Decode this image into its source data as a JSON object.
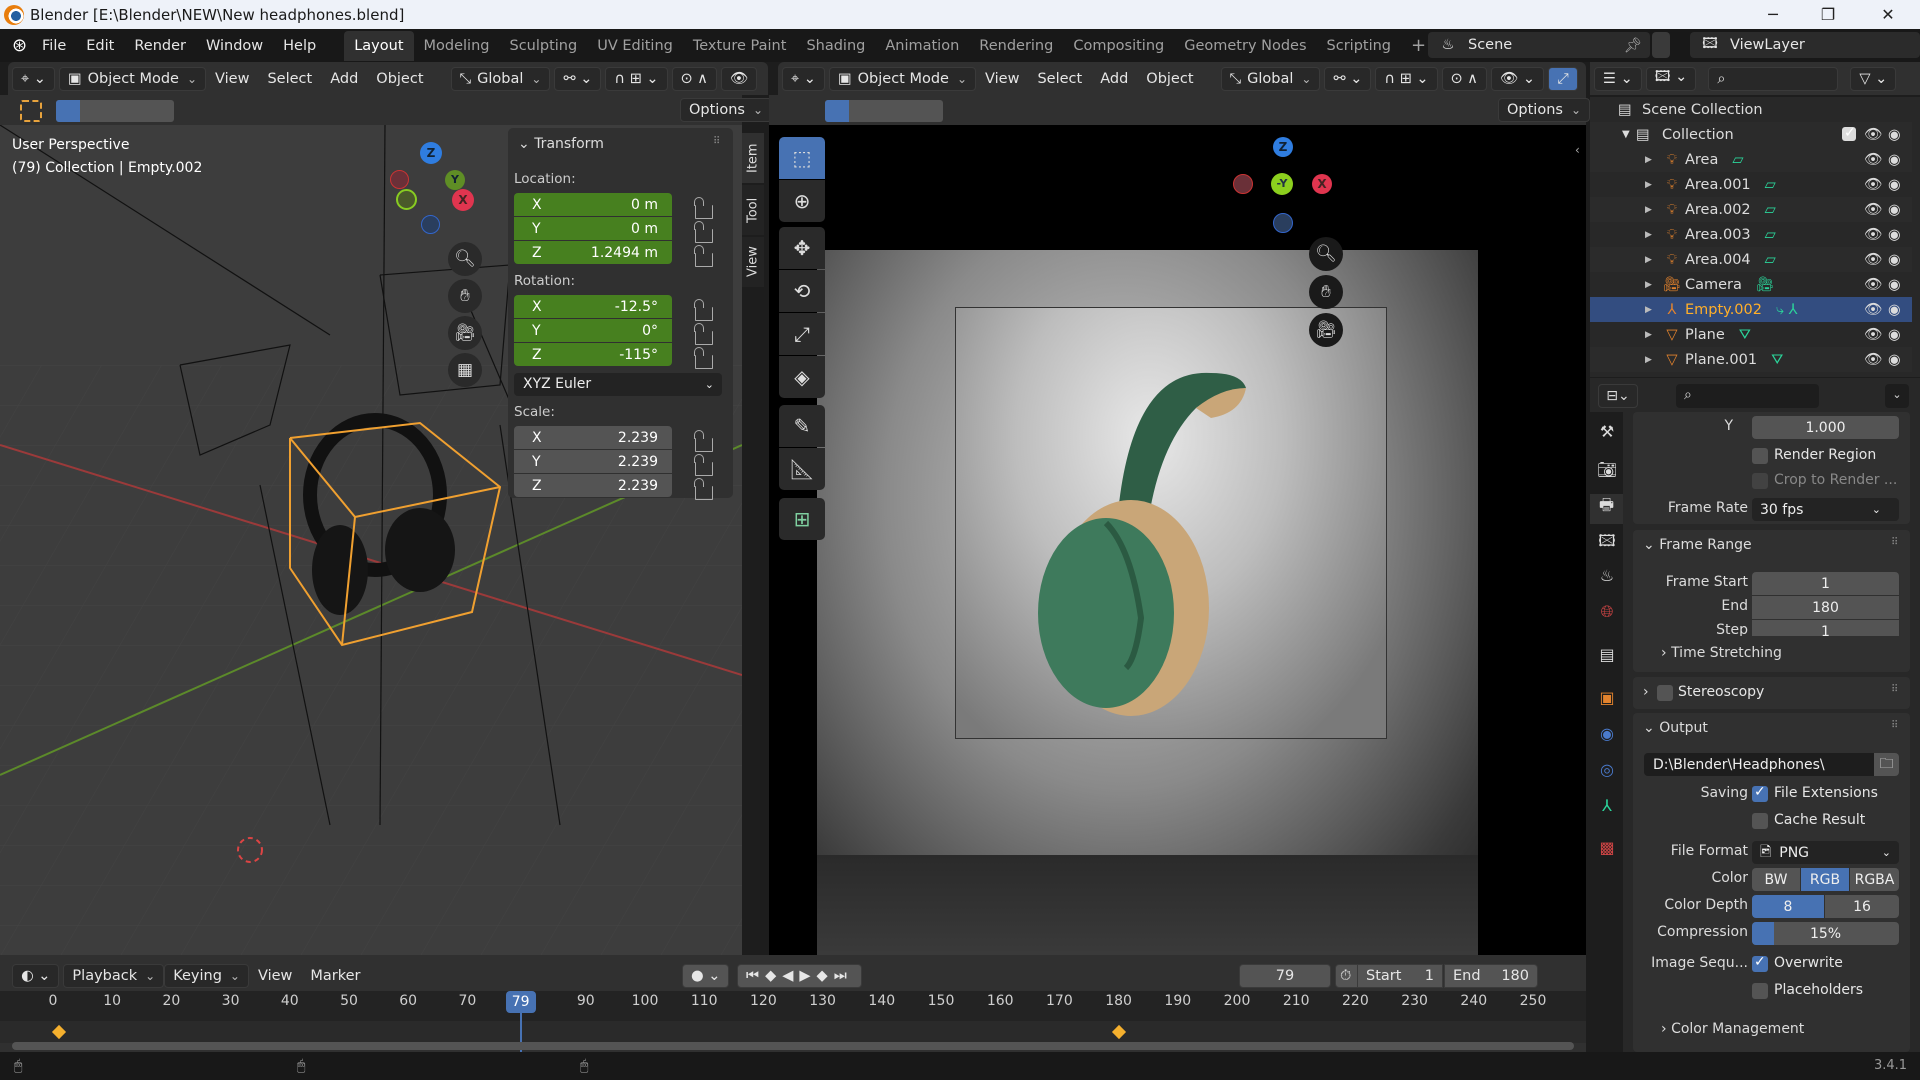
{
  "window": {
    "title": "Blender [E:\\Blender\\NEW\\New headphones.blend]",
    "controls": [
      "minimize",
      "maximize",
      "close"
    ]
  },
  "menu": [
    "File",
    "Edit",
    "Render",
    "Window",
    "Help"
  ],
  "workspaces": [
    {
      "label": "Layout",
      "active": true
    },
    {
      "label": "Modeling"
    },
    {
      "label": "Sculpting"
    },
    {
      "label": "UV Editing"
    },
    {
      "label": "Texture Paint"
    },
    {
      "label": "Shading"
    },
    {
      "label": "Animation"
    },
    {
      "label": "Rendering"
    },
    {
      "label": "Compositing"
    },
    {
      "label": "Geometry Nodes"
    },
    {
      "label": "Scripting"
    },
    {
      "label": "+"
    }
  ],
  "scene": {
    "name": "Scene",
    "view_layer": "ViewLayer"
  },
  "viewport_left": {
    "mode": "Object Mode",
    "menus": [
      "View",
      "Select",
      "Add",
      "Object"
    ],
    "orientation": "Global",
    "options_label": "Options",
    "overlay_title": "User Perspective",
    "overlay_subtitle": "(79) Collection | Empty.002",
    "gizmo_axes": [
      "Z",
      "Y",
      "X"
    ],
    "side_tabs": [
      "Item",
      "Tool",
      "View"
    ],
    "transform": {
      "title": "Transform",
      "location_label": "Location:",
      "location": [
        {
          "axis": "X",
          "value": "0 m"
        },
        {
          "axis": "Y",
          "value": "0 m"
        },
        {
          "axis": "Z",
          "value": "1.2494 m"
        }
      ],
      "rotation_label": "Rotation:",
      "rotation": [
        {
          "axis": "X",
          "value": "-12.5°"
        },
        {
          "axis": "Y",
          "value": "0°"
        },
        {
          "axis": "Z",
          "value": "-115°"
        }
      ],
      "rotation_mode": "XYZ Euler",
      "scale_label": "Scale:",
      "scale": [
        {
          "axis": "X",
          "value": "2.239"
        },
        {
          "axis": "Y",
          "value": "2.239"
        },
        {
          "axis": "Z",
          "value": "2.239"
        }
      ]
    }
  },
  "viewport_right": {
    "mode": "Object Mode",
    "menus": [
      "View",
      "Select",
      "Add",
      "Object"
    ],
    "orientation": "Global",
    "options_label": "Options",
    "gizmo_axes": [
      "Z",
      "-Y",
      "X"
    ]
  },
  "outliner": {
    "root": "Scene Collection",
    "collection": "Collection",
    "items": [
      {
        "name": "Area",
        "type": "light"
      },
      {
        "name": "Area.001",
        "type": "light"
      },
      {
        "name": "Area.002",
        "type": "light"
      },
      {
        "name": "Area.003",
        "type": "light"
      },
      {
        "name": "Area.004",
        "type": "light"
      },
      {
        "name": "Camera",
        "type": "camera"
      },
      {
        "name": "Empty.002",
        "type": "empty",
        "selected": true
      },
      {
        "name": "Plane",
        "type": "mesh"
      },
      {
        "name": "Plane.001",
        "type": "mesh"
      }
    ]
  },
  "properties": {
    "aspect_y_label": "Y",
    "aspect_y": "1.000",
    "render_region": "Render Region",
    "crop_to_render": "Crop to Render ...",
    "frame_rate_label": "Frame Rate",
    "frame_rate": "30 fps",
    "frame_range": {
      "title": "Frame Range",
      "start_label": "Frame Start",
      "start": "1",
      "end_label": "End",
      "end": "180",
      "step_label": "Step",
      "step": "1"
    },
    "time_stretching": "Time Stretching",
    "stereoscopy": "Stereoscopy",
    "output": {
      "title": "Output",
      "path": "D:\\Blender\\Headphones\\",
      "saving_label": "Saving",
      "file_extensions": "File Extensions",
      "cache_result": "Cache Result",
      "file_format_label": "File Format",
      "file_format": "PNG",
      "color_label": "Color",
      "color_options": [
        "BW",
        "RGB",
        "RGBA"
      ],
      "color_selected": "RGB",
      "color_depth_label": "Color Depth",
      "color_depth_options": [
        "8",
        "16"
      ],
      "color_depth_selected": "8",
      "compression_label": "Compression",
      "compression": "15%",
      "compression_value": 0.15,
      "image_seq_label": "Image Sequ...",
      "overwrite": "Overwrite",
      "placeholders": "Placeholders"
    },
    "color_management": "Color Management"
  },
  "timeline": {
    "menus": [
      "Playback",
      "Keying",
      "View",
      "Marker"
    ],
    "current_frame": "79",
    "start_label": "Start",
    "start": "1",
    "end_label": "End",
    "end": "180",
    "ticks": [
      "0",
      "10",
      "20",
      "30",
      "40",
      "50",
      "60",
      "70",
      "79",
      "90",
      "100",
      "110",
      "120",
      "130",
      "140",
      "150",
      "160",
      "170",
      "180",
      "190",
      "200",
      "210",
      "220",
      "230",
      "240",
      "250"
    ],
    "keyframes": [
      1,
      180
    ]
  },
  "status": {
    "version": "3.4.1"
  }
}
